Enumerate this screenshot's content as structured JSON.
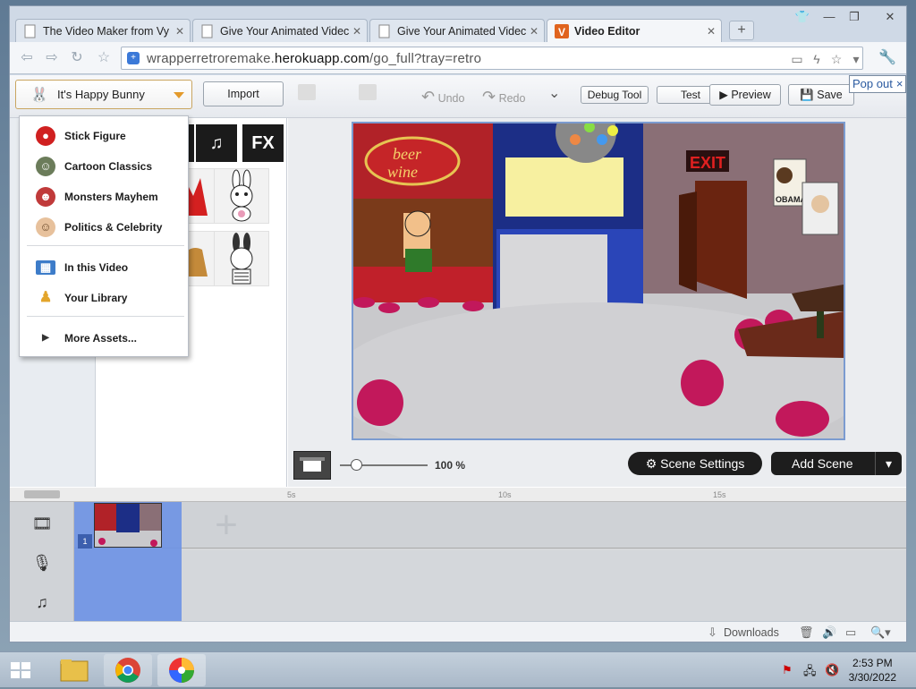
{
  "browser": {
    "tabs": [
      {
        "title": "The Video Maker from Vy"
      },
      {
        "title": "Give Your Animated Videc"
      },
      {
        "title": "Give Your Animated Videc"
      },
      {
        "title": "Video Editor",
        "active": true
      }
    ],
    "url_prefix": "wrapperretroremake.",
    "url_domain": "herokuapp.com",
    "url_path": "/go_full?tray=retro"
  },
  "app": {
    "theme_label": "It's Happy Bunny",
    "import_label": "Import",
    "undo_label": "Undo",
    "redo_label": "Redo",
    "debug_label": "Debug Tool",
    "test_label": "Test",
    "preview_label": "Preview",
    "save_label": "Save",
    "popout_label": "Pop out",
    "popout_close": "×",
    "category_music": "♫",
    "category_fx": "FX"
  },
  "dropdown": {
    "items": [
      {
        "label": "Stick Figure",
        "icon": "stick-figure-icon"
      },
      {
        "label": "Cartoon Classics",
        "icon": "cartoon-classics-icon"
      },
      {
        "label": "Monsters Mayhem",
        "icon": "monsters-icon"
      },
      {
        "label": "Politics & Celebrity",
        "icon": "politics-icon"
      },
      {
        "label": "In this Video",
        "icon": "film-icon"
      },
      {
        "label": "Your Library",
        "icon": "library-icon"
      },
      {
        "label": "More Assets...",
        "icon": "play-arrow-icon"
      }
    ]
  },
  "stage": {
    "sign_line1": "beer",
    "sign_line2": "wine",
    "exit_sign": "EXIT",
    "poster_label": "OBAMA"
  },
  "zoom": {
    "value": "100 %",
    "level_percent": 100,
    "scene_settings_label": "Scene Settings",
    "add_scene_label": "Add Scene"
  },
  "timeline": {
    "ticks": [
      "5s",
      "10s",
      "15s"
    ],
    "scene_number": "1"
  },
  "statusbar": {
    "downloads_label": "Downloads"
  },
  "taskbar": {
    "time": "2:53 PM",
    "date": "3/30/2022"
  },
  "colors": {
    "accent": "#e39a2b",
    "selection": "#6d92e4",
    "dark_button": "#1d1d1d"
  }
}
